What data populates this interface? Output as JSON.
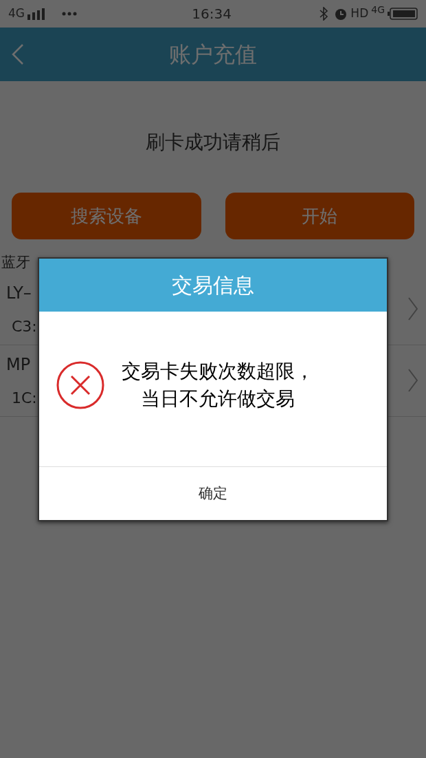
{
  "status_bar": {
    "network_left": "4G",
    "time": "16:34",
    "hd": "HD",
    "network_right": "4G"
  },
  "header": {
    "title": "账户充值"
  },
  "status_text": "刷卡成功请稍后",
  "buttons": [
    {
      "label": "搜索设备"
    },
    {
      "label": "开始"
    }
  ],
  "device_section": {
    "label": "蓝牙",
    "devices": [
      {
        "name": "LY–",
        "address": "C3:"
      },
      {
        "name": "MP",
        "address": "1C:"
      }
    ]
  },
  "dialog": {
    "title": "交易信息",
    "message_lines": [
      "交易卡失败次数超限，",
      "当日不允许做交易"
    ],
    "confirm": "确定"
  }
}
